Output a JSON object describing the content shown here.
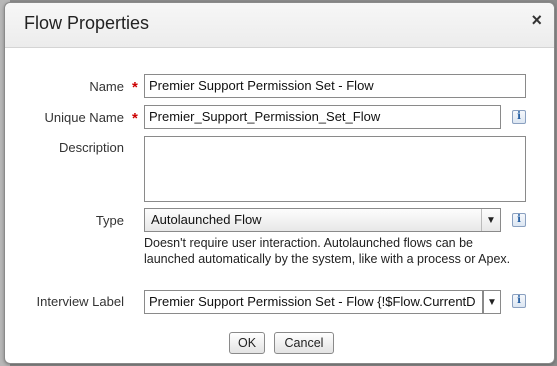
{
  "dialog": {
    "title": "Flow Properties",
    "close_label": "×"
  },
  "form": {
    "name": {
      "label": "Name",
      "required_marker": "*",
      "value": "Premier Support Permission Set - Flow"
    },
    "unique_name": {
      "label": "Unique Name",
      "required_marker": "*",
      "value": "Premier_Support_Permission_Set_Flow",
      "info": "i"
    },
    "description": {
      "label": "Description",
      "value": ""
    },
    "type": {
      "label": "Type",
      "value": "Autolaunched Flow",
      "info": "i",
      "help_text": "Doesn't require user interaction. Autolaunched flows can be launched automatically by the system, like with a process or Apex."
    },
    "interview_label": {
      "label": "Interview Label",
      "value": "Premier Support Permission Set - Flow {!$Flow.CurrentD",
      "info": "i"
    }
  },
  "buttons": {
    "ok": "OK",
    "cancel": "Cancel"
  },
  "icons": {
    "close": "close-icon",
    "info": "info-icon",
    "dropdown": "chevron-down-icon"
  }
}
